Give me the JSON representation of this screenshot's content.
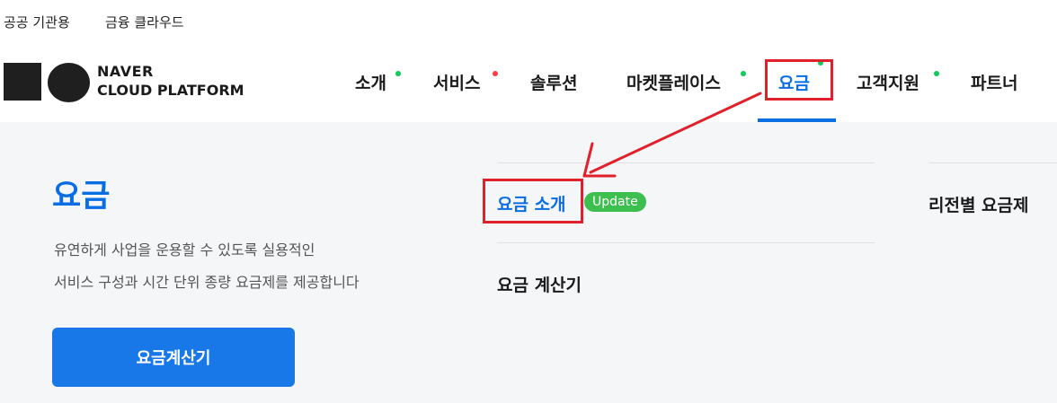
{
  "topbar": {
    "links": [
      {
        "label": "공공 기관용"
      },
      {
        "label": "금융 클라우드"
      }
    ]
  },
  "brand": {
    "line1": "NAVER",
    "line2": "CLOUD PLATFORM"
  },
  "nav": {
    "items": [
      {
        "label": "소개",
        "dot": "green"
      },
      {
        "label": "서비스",
        "dot": "red"
      },
      {
        "label": "솔루션"
      },
      {
        "label": "마켓플레이스",
        "dot": "green"
      },
      {
        "label": "요금",
        "dot": "green",
        "active": true
      },
      {
        "label": "고객지원",
        "dot": "green"
      },
      {
        "label": "파트너"
      }
    ]
  },
  "hero": {
    "title": "요금",
    "desc_line1": "유연하게 사업을 운용할 수 있도록 실용적인",
    "desc_line2": "서비스 구성과 시간 단위 종량 요금제를 제공합니다",
    "button": "요금계산기"
  },
  "submenu": {
    "intro": "요금 소개",
    "badge": "Update",
    "calculator": "요금 계산기",
    "regional": "리전별 요금제"
  },
  "colors": {
    "accent": "#0a6de4",
    "annotation": "#e0202a",
    "badge": "#3cbf4f",
    "dot_green": "#16c75c",
    "dot_red": "#ff3b47"
  }
}
